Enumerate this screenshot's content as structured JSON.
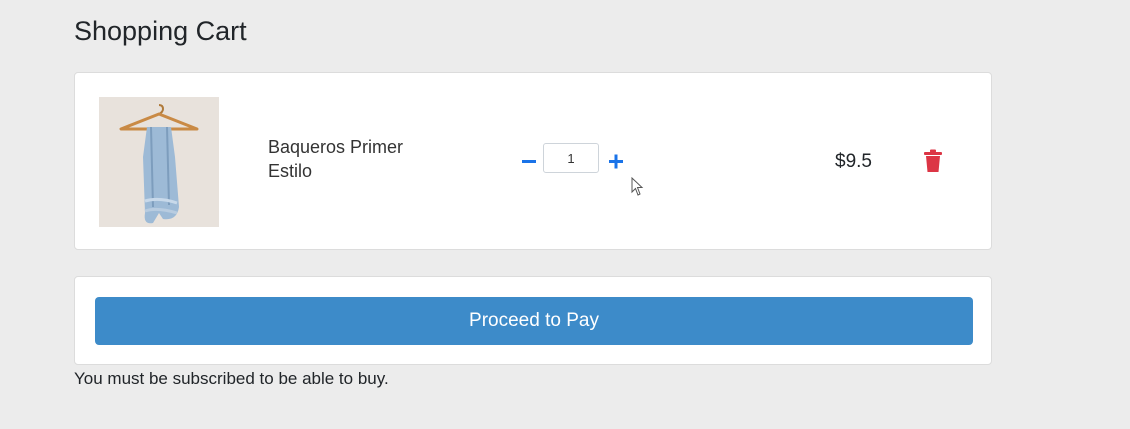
{
  "page": {
    "title": "Shopping Cart"
  },
  "cart": {
    "items": [
      {
        "name": "Baqueros Primer Estilo",
        "quantity": "1",
        "price": "$9.5",
        "image_icon": "jeans-on-hanger-image"
      }
    ]
  },
  "controls": {
    "decrease_icon": "minus-icon",
    "increase_icon": "plus-icon",
    "remove_icon": "trash-icon"
  },
  "checkout": {
    "pay_label": "Proceed to Pay",
    "notice": "You must be subscribed to be able to buy."
  },
  "colors": {
    "background": "#ececec",
    "accent": "#1a73e8",
    "pay_button": "#3d8bc9",
    "danger": "#dc3545"
  }
}
